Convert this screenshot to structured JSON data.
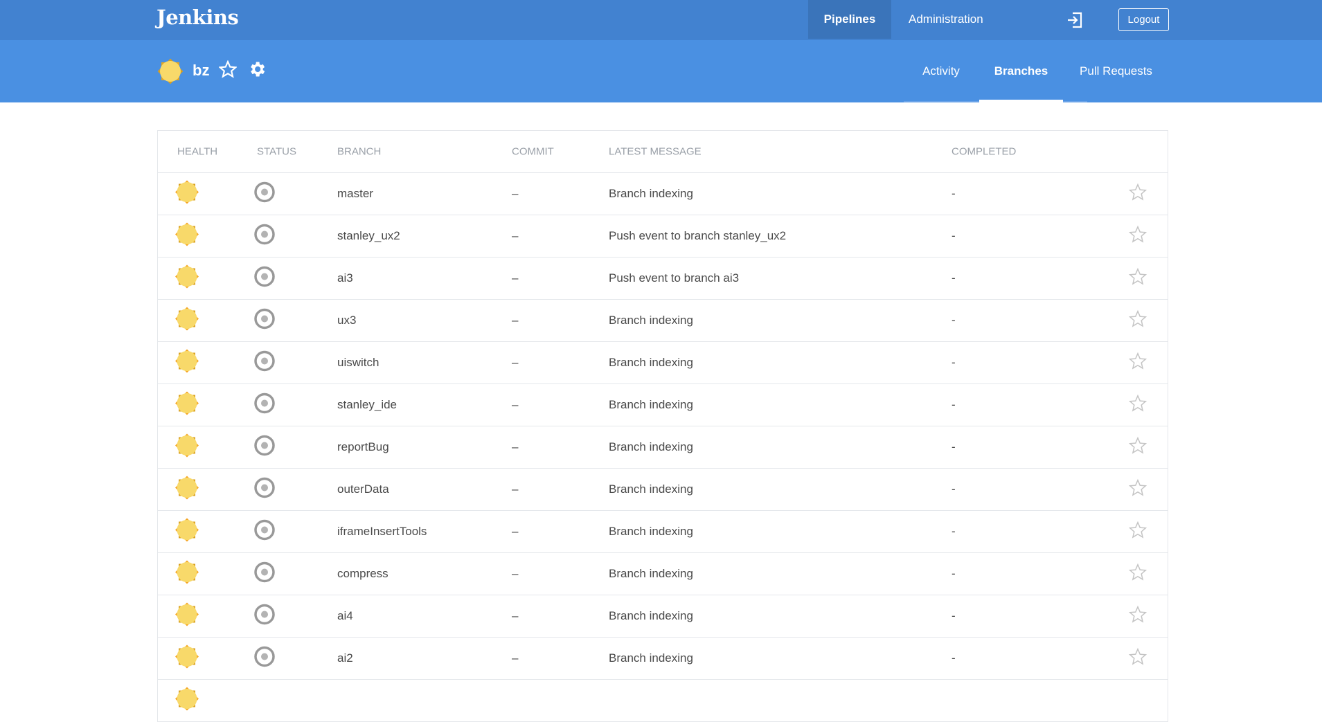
{
  "topbar": {
    "logo": "Jenkins",
    "nav": [
      {
        "label": "Pipelines",
        "active": true
      },
      {
        "label": "Administration"
      }
    ],
    "logout": "Logout"
  },
  "pipeline": {
    "name": "bz",
    "tabs": [
      {
        "label": "Activity"
      },
      {
        "label": "Branches",
        "active": true
      },
      {
        "label": "Pull Requests"
      }
    ]
  },
  "table": {
    "headers": [
      "Health",
      "Status",
      "Branch",
      "Commit",
      "Latest Message",
      "Completed"
    ],
    "rows": [
      {
        "branch": "master",
        "commit": "–",
        "message": "Branch indexing",
        "completed": "-"
      },
      {
        "branch": "stanley_ux2",
        "commit": "–",
        "message": "Push event to branch stanley_ux2",
        "completed": "-"
      },
      {
        "branch": "ai3",
        "commit": "–",
        "message": "Push event to branch ai3",
        "completed": "-"
      },
      {
        "branch": "ux3",
        "commit": "–",
        "message": "Branch indexing",
        "completed": "-"
      },
      {
        "branch": "uiswitch",
        "commit": "–",
        "message": "Branch indexing",
        "completed": "-"
      },
      {
        "branch": "stanley_ide",
        "commit": "–",
        "message": "Branch indexing",
        "completed": "-"
      },
      {
        "branch": "reportBug",
        "commit": "–",
        "message": "Branch indexing",
        "completed": "-"
      },
      {
        "branch": "outerData",
        "commit": "–",
        "message": "Branch indexing",
        "completed": "-"
      },
      {
        "branch": "iframeInsertTools",
        "commit": "–",
        "message": "Branch indexing",
        "completed": "-"
      },
      {
        "branch": "compress",
        "commit": "–",
        "message": "Branch indexing",
        "completed": "-"
      },
      {
        "branch": "ai4",
        "commit": "–",
        "message": "Branch indexing",
        "completed": "-"
      },
      {
        "branch": "ai2",
        "commit": "–",
        "message": "Branch indexing",
        "completed": "-"
      }
    ]
  },
  "colors": {
    "topbar": "#4282d0",
    "subbar": "#4a90e2",
    "sun": "#f8d96a",
    "sun_rays": "#f5a623",
    "status_ring": "#999999"
  }
}
